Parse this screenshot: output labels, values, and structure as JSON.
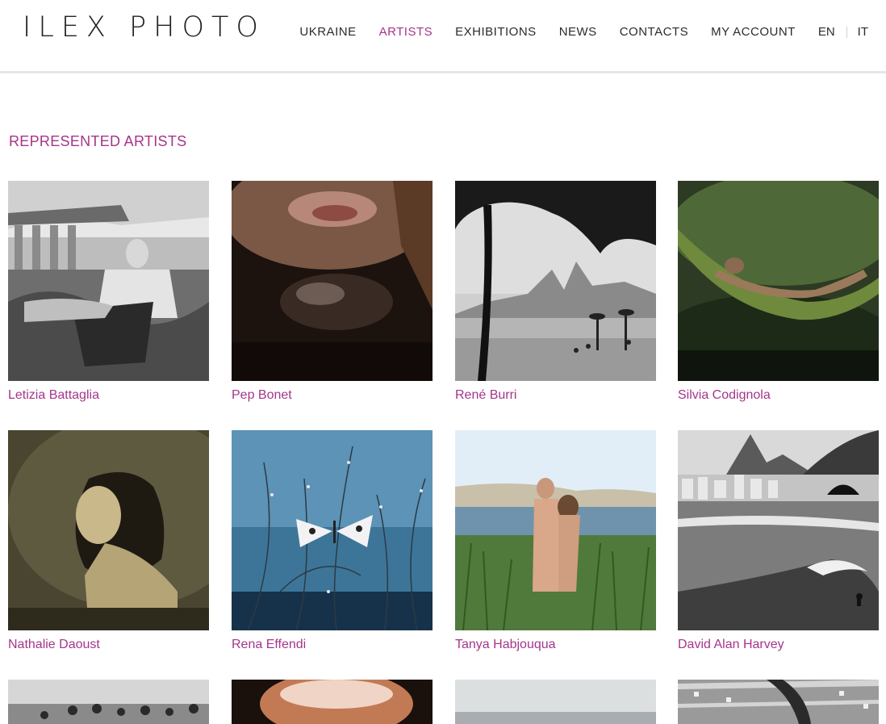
{
  "logo": "ILEX PHOTO",
  "nav": {
    "items": [
      "UKRAINE",
      "ARTISTS",
      "EXHIBITIONS",
      "NEWS",
      "CONTACTS",
      "MY ACCOUNT"
    ],
    "active": "ARTISTS",
    "languages": [
      "EN",
      "IT"
    ]
  },
  "section_title": "REPRESENTED ARTISTS",
  "artists": [
    "Letizia Battaglia",
    "Pep Bonet",
    "René Burri",
    "Silvia Codignola",
    "Nathalie Daoust",
    "Rena Effendi",
    "Tanya Habjouqua",
    "David Alan Harvey"
  ],
  "colors": {
    "accent": "#a5358a",
    "text": "#2b2b2b",
    "divider": "#e6e6e6"
  }
}
